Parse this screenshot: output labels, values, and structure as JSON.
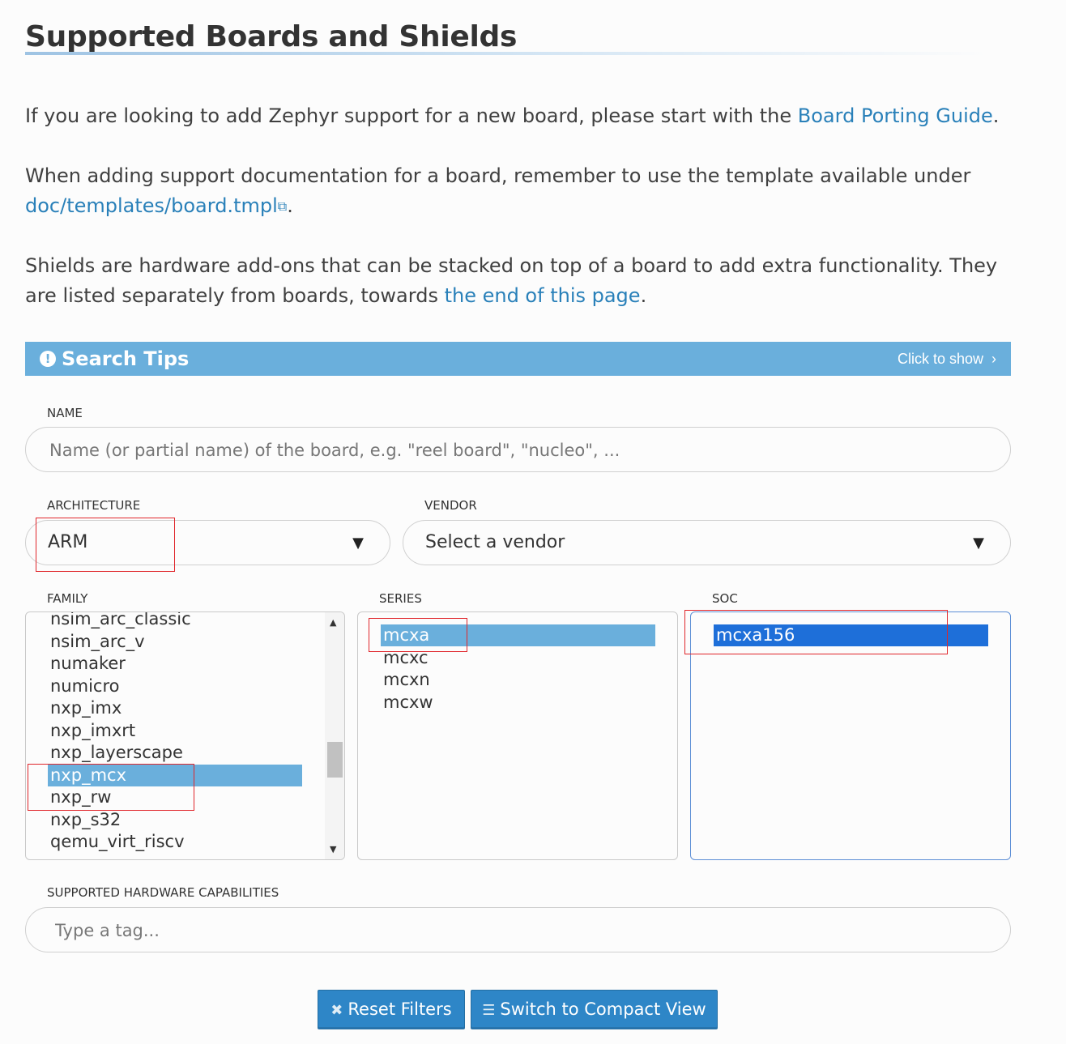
{
  "heading": "Supported Boards and Shields",
  "intro": {
    "p1_text": "If you are looking to add Zephyr support for a new board, please start with the ",
    "p1_link": "Board Porting Guide",
    "p2_text": "When adding support documentation for a board, remember to use the template available under",
    "p2_link": "doc/templates/board.tmpl",
    "p3_text": "Shields are hardware add-ons that can be stacked on top of a board to add extra functionality. They are listed separately from boards, towards ",
    "p3_link": "the end of this page"
  },
  "search_tips": {
    "title": "Search Tips",
    "toggle": "Click to show"
  },
  "filters": {
    "name": {
      "label": "NAME",
      "placeholder": "Name (or partial name) of the board, e.g. \"reel board\", \"nucleo\", ..."
    },
    "architecture": {
      "label": "ARCHITECTURE",
      "value": "ARM"
    },
    "vendor": {
      "label": "VENDOR",
      "value": "Select a vendor"
    },
    "family": {
      "label": "FAMILY",
      "options": [
        "nsim_arc_classic",
        "nsim_arc_v",
        "numaker",
        "numicro",
        "nxp_imx",
        "nxp_imxrt",
        "nxp_layerscape",
        "nxp_mcx",
        "nxp_rw",
        "nxp_s32",
        "qemu_virt_riscv"
      ],
      "selected": "nxp_mcx"
    },
    "series": {
      "label": "SERIES",
      "options": [
        "mcxa",
        "mcxc",
        "mcxn",
        "mcxw"
      ],
      "selected": "mcxa"
    },
    "soc": {
      "label": "SOC",
      "options": [
        "mcxa156"
      ],
      "selected": "mcxa156"
    },
    "capabilities": {
      "label": "SUPPORTED HARDWARE CAPABILITIES",
      "placeholder": "Type a tag..."
    }
  },
  "buttons": {
    "reset": "Reset Filters",
    "compact": "Switch to Compact View"
  }
}
